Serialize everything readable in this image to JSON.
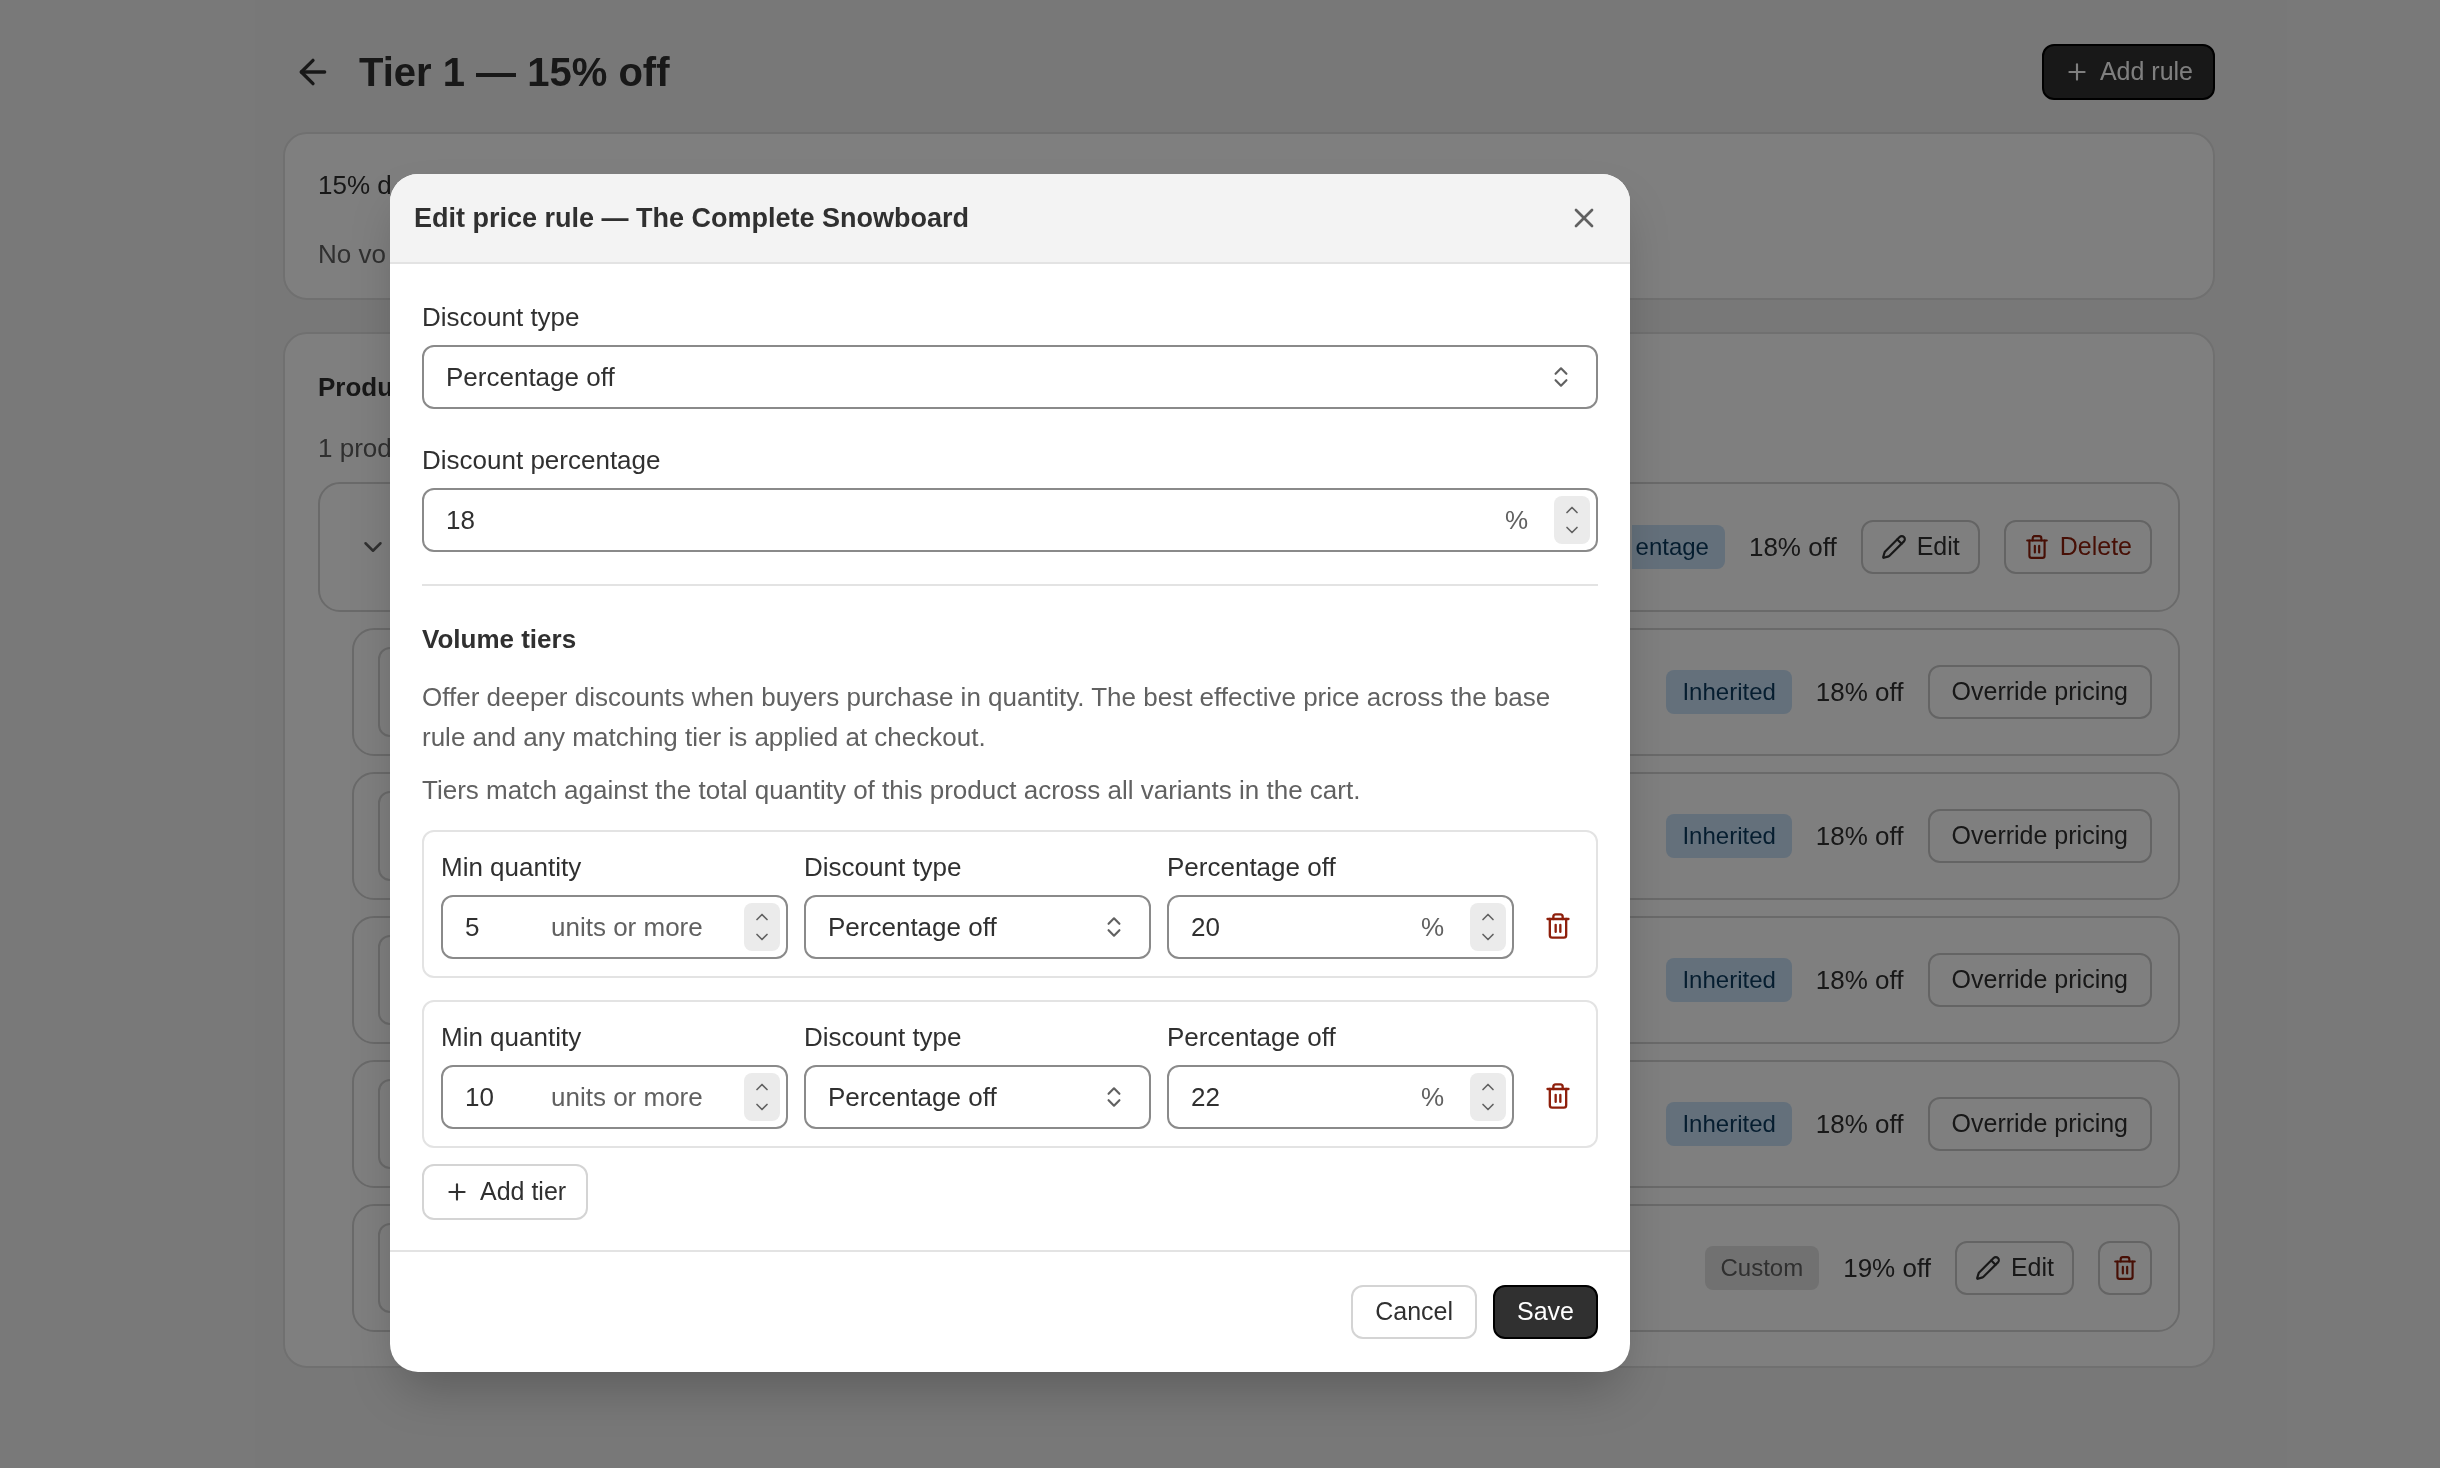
{
  "page": {
    "title": "Tier 1 — 15% off",
    "add_rule_button": "Add rule"
  },
  "summary_card": {
    "line_1": "15% d",
    "line_2": "No vo"
  },
  "products_card": {
    "title": "Produ",
    "count": "1 prod",
    "product_row": {
      "badge": "entage",
      "discount": "18% off",
      "edit_button": "Edit",
      "delete_button": "Delete"
    },
    "variants": [
      {
        "kind": "inherited",
        "badge": "Inherited",
        "discount": "18% off",
        "button": "Override pricing"
      },
      {
        "kind": "inherited",
        "badge": "Inherited",
        "discount": "18% off",
        "button": "Override pricing"
      },
      {
        "kind": "inherited",
        "badge": "Inherited",
        "discount": "18% off",
        "button": "Override pricing"
      },
      {
        "kind": "inherited",
        "badge": "Inherited",
        "discount": "18% off",
        "button": "Override pricing"
      },
      {
        "kind": "custom",
        "badge": "Custom",
        "discount": "19% off",
        "button": "Edit"
      }
    ]
  },
  "modal": {
    "title": "Edit price rule — The Complete Snowboard",
    "discount_type": {
      "label": "Discount type",
      "value": "Percentage off"
    },
    "discount_percentage": {
      "label": "Discount percentage",
      "value": "18",
      "suffix": "%"
    },
    "volume_tiers": {
      "title": "Volume tiers",
      "description": "Offer deeper discounts when buyers purchase in quantity. The best effective price across the base rule and any matching tier is applied at checkout.",
      "note": "Tiers match against the total quantity of this product across all variants in the cart.",
      "tiers": [
        {
          "min_label": "Min quantity",
          "min_value": "5",
          "unit": "units or more",
          "type_label": "Discount type",
          "type_value": "Percentage off",
          "pct_label": "Percentage off",
          "pct_value": "20",
          "suffix": "%"
        },
        {
          "min_label": "Min quantity",
          "min_value": "10",
          "unit": "units or more",
          "type_label": "Discount type",
          "type_value": "Percentage off",
          "pct_label": "Percentage off",
          "pct_value": "22",
          "suffix": "%"
        }
      ],
      "add_button": "Add tier"
    },
    "cancel_button": "Cancel",
    "save_button": "Save"
  }
}
